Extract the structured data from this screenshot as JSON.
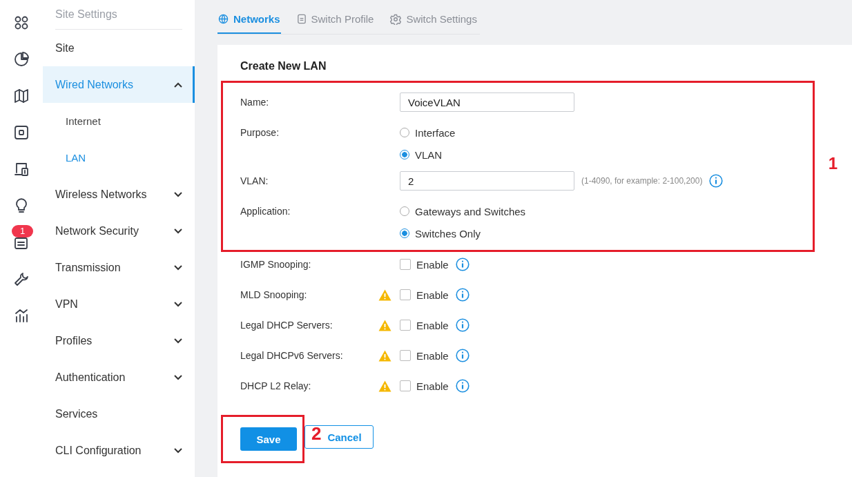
{
  "rail": {
    "badge": "1"
  },
  "sidebar": {
    "heading": "Site Settings",
    "items": [
      {
        "label": "Site",
        "kind": "link",
        "selected": false
      },
      {
        "label": "Wired Networks",
        "kind": "group",
        "selected": true,
        "expanded": true,
        "children": [
          {
            "label": "Internet",
            "selected": false
          },
          {
            "label": "LAN",
            "selected": true
          }
        ]
      },
      {
        "label": "Wireless Networks",
        "kind": "group",
        "selected": false,
        "expanded": false
      },
      {
        "label": "Network Security",
        "kind": "group",
        "selected": false,
        "expanded": false
      },
      {
        "label": "Transmission",
        "kind": "group",
        "selected": false,
        "expanded": false
      },
      {
        "label": "VPN",
        "kind": "group",
        "selected": false,
        "expanded": false
      },
      {
        "label": "Profiles",
        "kind": "group",
        "selected": false,
        "expanded": false
      },
      {
        "label": "Authentication",
        "kind": "group",
        "selected": false,
        "expanded": false
      },
      {
        "label": "Services",
        "kind": "link",
        "selected": false
      },
      {
        "label": "CLI Configuration",
        "kind": "group",
        "selected": false,
        "expanded": false
      }
    ]
  },
  "tabs": [
    {
      "label": "Networks",
      "selected": true
    },
    {
      "label": "Switch Profile",
      "selected": false
    },
    {
      "label": "Switch Settings",
      "selected": false
    }
  ],
  "form": {
    "title": "Create New LAN",
    "highlighted_fields": [
      {
        "kind": "text",
        "label": "Name:",
        "value": "VoiceVLAN"
      },
      {
        "kind": "radio",
        "label": "Purpose:",
        "options": [
          {
            "label": "Interface",
            "selected": false
          },
          {
            "label": "VLAN",
            "selected": true
          }
        ]
      },
      {
        "kind": "text",
        "label": "VLAN:",
        "value": "2",
        "hint": "(1-4090, for example: 2-100,200)",
        "info": true
      },
      {
        "kind": "radio",
        "label": "Application:",
        "options": [
          {
            "label": "Gateways and Switches",
            "selected": false
          },
          {
            "label": "Switches Only",
            "selected": true
          }
        ]
      }
    ],
    "fields": [
      {
        "kind": "checkbox",
        "label": "IGMP Snooping:",
        "warning": false,
        "option": "Enable",
        "checked": false,
        "info": true
      },
      {
        "kind": "checkbox",
        "label": "MLD Snooping:",
        "warning": true,
        "option": "Enable",
        "checked": false,
        "info": true
      },
      {
        "kind": "checkbox",
        "label": "Legal DHCP Servers:",
        "warning": true,
        "option": "Enable",
        "checked": false,
        "info": true
      },
      {
        "kind": "checkbox",
        "label": "Legal DHCPv6 Servers:",
        "warning": true,
        "option": "Enable",
        "checked": false,
        "info": true
      },
      {
        "kind": "checkbox",
        "label": "DHCP L2 Relay:",
        "warning": true,
        "option": "Enable",
        "checked": false,
        "info": true
      }
    ],
    "buttons": {
      "save": "Save",
      "cancel": "Cancel"
    }
  },
  "annotations": [
    {
      "label": "1"
    },
    {
      "label": "2"
    }
  ]
}
